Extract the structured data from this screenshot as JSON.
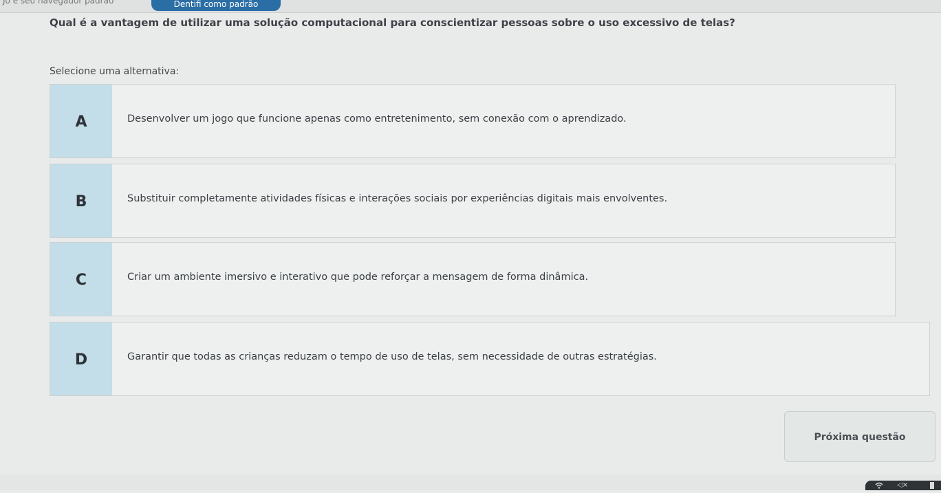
{
  "topbar": {
    "left_text": "Jo e seu navegador padrão",
    "button_label": "Dentifi como padrão"
  },
  "question": "Qual é a vantagem de utilizar uma solução computacional para conscientizar pessoas sobre o uso excessivo de telas?",
  "prompt": "Selecione uma alternativa:",
  "options": [
    {
      "letter": "A",
      "text": "Desenvolver um jogo que funcione apenas como entretenimento, sem conexão com o aprendizado."
    },
    {
      "letter": "B",
      "text": "Substituir completamente atividades físicas e interações sociais por experiências digitais mais envolventes."
    },
    {
      "letter": "C",
      "text": "Criar um ambiente imersivo e interativo que pode reforçar a mensagem de forma dinâmica."
    },
    {
      "letter": "D",
      "text": "Garantir que todas as crianças reduzam o tempo de uso de telas, sem necessidade de outras estratégias."
    }
  ],
  "next_button": "Próxima questão",
  "tray": {
    "icons": [
      "wifi-icon",
      "speaker-icon",
      "battery-icon"
    ],
    "volume_glyph": "◁×"
  }
}
